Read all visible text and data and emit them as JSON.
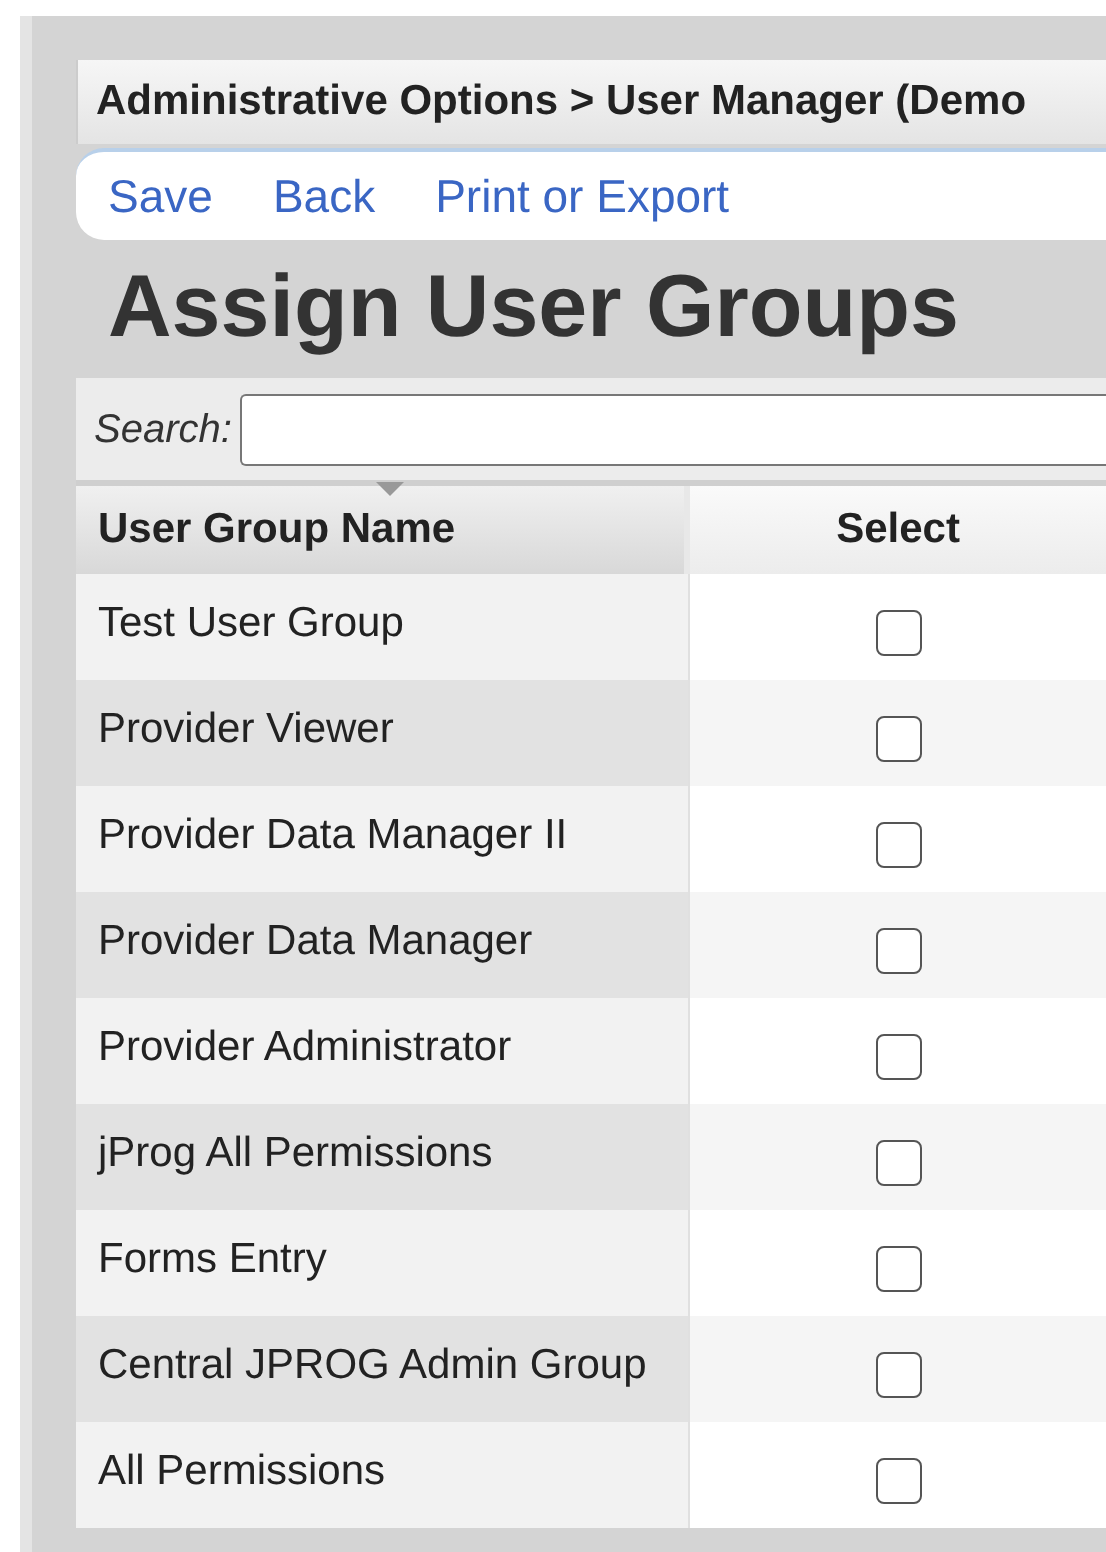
{
  "breadcrumb": "Administrative Options > User Manager (Demo",
  "toolbar": [
    "Save",
    "Back",
    "Print or Export"
  ],
  "title": "Assign User Groups",
  "search": {
    "label": "Search:"
  },
  "table": {
    "columns": [
      {
        "label": "User Group Name",
        "sorted": true
      },
      {
        "label": "Select",
        "sorted": false
      }
    ],
    "rows": [
      {
        "name": "Test User Group",
        "checked": false
      },
      {
        "name": "Provider Viewer",
        "checked": false
      },
      {
        "name": "Provider Data Manager II",
        "checked": false
      },
      {
        "name": "Provider Data Manager",
        "checked": false
      },
      {
        "name": "Provider Administrator",
        "checked": false
      },
      {
        "name": "jProg All Permissions",
        "checked": false
      },
      {
        "name": "Forms Entry",
        "checked": false
      },
      {
        "name": "Central JPROG Admin Group",
        "checked": false
      },
      {
        "name": "All Permissions",
        "checked": false
      }
    ]
  }
}
